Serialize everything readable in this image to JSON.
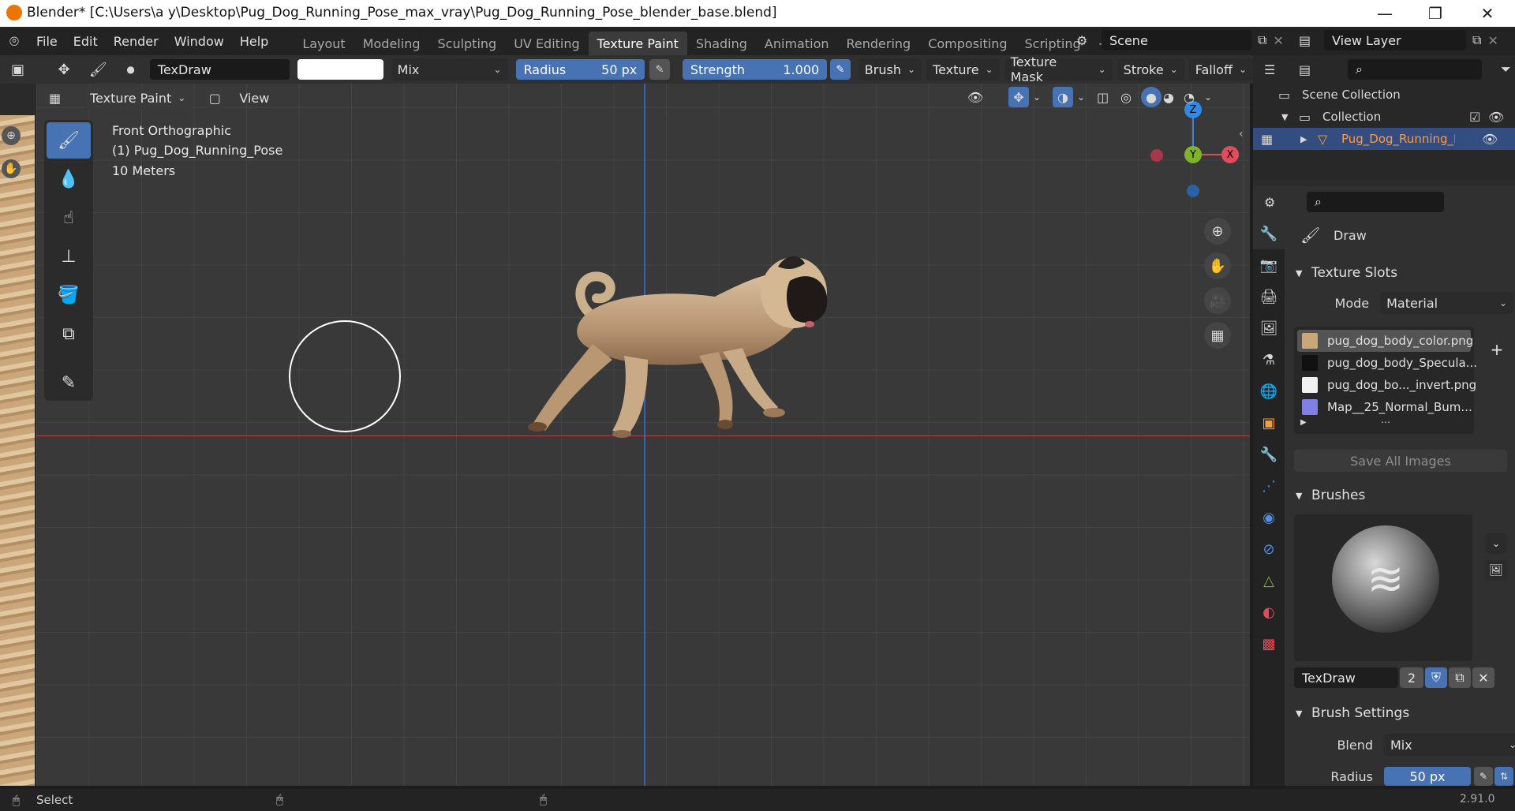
{
  "window": {
    "title": "Blender* [C:\\Users\\a y\\Desktop\\Pug_Dog_Running_Pose_max_vray\\Pug_Dog_Running_Pose_blender_base.blend]",
    "minimize": "—",
    "maximize": "❐",
    "close": "✕"
  },
  "menu": [
    "File",
    "Edit",
    "Render",
    "Window",
    "Help"
  ],
  "workspaces": {
    "tabs": [
      "Layout",
      "Modeling",
      "Sculpting",
      "UV Editing",
      "Texture Paint",
      "Shading",
      "Animation",
      "Rendering",
      "Compositing",
      "Scripting"
    ],
    "active": "Texture Paint",
    "add": "+"
  },
  "scene": {
    "name": "Scene",
    "view_layer": "View Layer"
  },
  "tool_header": {
    "brush_name": "TexDraw",
    "blend_mode": "Mix",
    "radius_label": "Radius",
    "radius_value": "50 px",
    "strength_label": "Strength",
    "strength_value": "1.000",
    "menus": [
      "Brush",
      "Texture",
      "Texture Mask",
      "Stroke",
      "Falloff"
    ]
  },
  "view_header": {
    "mode": "Texture Paint",
    "view_menu": "View"
  },
  "viewport": {
    "view_name": "Front Orthographic",
    "object": "(1) Pug_Dog_Running_Pose",
    "scale": "10 Meters",
    "gizmo": {
      "z": "Z",
      "y": "Y",
      "x": "X"
    }
  },
  "outliner": {
    "scene_collection": "Scene Collection",
    "collection": "Collection",
    "object": "Pug_Dog_Running_Pose"
  },
  "properties": {
    "tool_name": "Draw",
    "texture_slots": {
      "title": "Texture Slots",
      "mode_label": "Mode",
      "mode_value": "Material",
      "slots": [
        {
          "name": "pug_dog_body_color.png",
          "color": "#c9a77a"
        },
        {
          "name": "pug_dog_body_Specula...",
          "color": "#111111"
        },
        {
          "name": "pug_dog_bo..._invert.png",
          "color": "#f2f2f2"
        },
        {
          "name": "Map__25_Normal_Bum...",
          "color": "#7f7fe6"
        }
      ],
      "save_all": "Save All Images"
    },
    "brushes": {
      "title": "Brushes",
      "brush_name": "TexDraw",
      "users": "2"
    },
    "brush_settings": {
      "title": "Brush Settings",
      "blend_label": "Blend",
      "blend_value": "Mix",
      "radius_label": "Radius",
      "radius_value": "50 px"
    }
  },
  "status": {
    "select": "Select",
    "version": "2.91.0"
  },
  "colors": {
    "accent": "#4772b3",
    "x_axis": "#e04d5a",
    "y_axis": "#7fb32b",
    "z_axis": "#2e8ae6",
    "selected_object": "#ff9a3c"
  }
}
